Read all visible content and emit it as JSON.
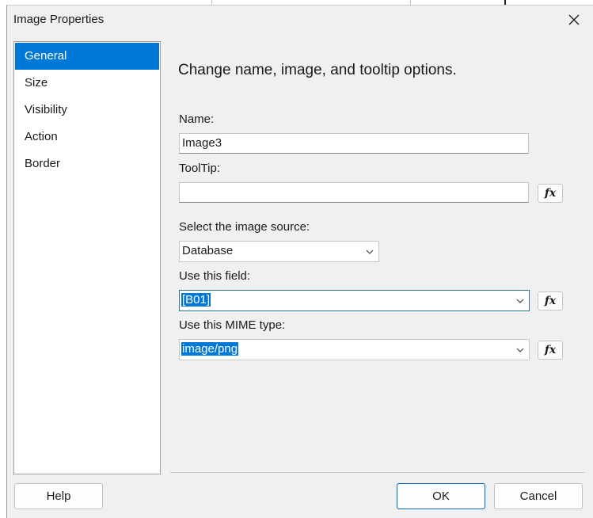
{
  "window": {
    "title": "Image Properties"
  },
  "nav": {
    "items": [
      {
        "label": "General",
        "selected": true
      },
      {
        "label": "Size",
        "selected": false
      },
      {
        "label": "Visibility",
        "selected": false
      },
      {
        "label": "Action",
        "selected": false
      },
      {
        "label": "Border",
        "selected": false
      }
    ]
  },
  "page": {
    "heading": "Change name, image, and tooltip options.",
    "name": {
      "label": "Name:",
      "value": "Image3"
    },
    "tooltip": {
      "label": "ToolTip:",
      "value": ""
    },
    "source": {
      "label": "Select the image source:",
      "value": "Database"
    },
    "field": {
      "label": "Use this field:",
      "value": "[B01]"
    },
    "mime": {
      "label": "Use this MIME type:",
      "value": "image/png"
    },
    "fx_label": "fx"
  },
  "buttons": {
    "help": "Help",
    "ok": "OK",
    "cancel": "Cancel"
  },
  "colors": {
    "accent": "#0078d7",
    "dialog_bg": "#f0f0f0"
  },
  "icons": {
    "close": "close-icon",
    "dropdown": "chevron-down-icon"
  }
}
